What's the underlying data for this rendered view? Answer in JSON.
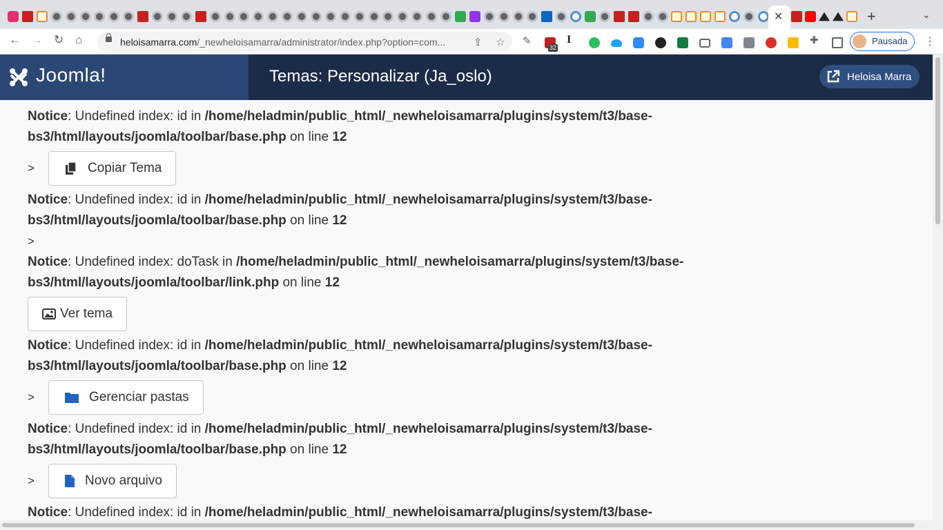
{
  "browser": {
    "tab_close": "✕",
    "new_tab": "+",
    "url_host": "heloisamarra.com",
    "url_path": "/_newheloisamarra/administrator/index.php?option=com...",
    "ext_badge": "32",
    "profile_label": "Pausada",
    "nav_icons": [
      "back-icon",
      "forward-icon",
      "reload-icon",
      "home-icon"
    ]
  },
  "header": {
    "logo_text": "Joomla!",
    "title": "Temas: Personalizar (Ja_oslo)",
    "user_name": "Heloisa Marra"
  },
  "notices": [
    {
      "label": "Notice",
      "msg": ": Undefined index: id in ",
      "path": "/home/heladmin/public_html/_newheloisamarra/plugins/system/t3/base-bs3/html/layouts/joomla/toolbar/base.php",
      "online": " on line ",
      "line": "12"
    },
    {
      "label": "Notice",
      "msg": ": Undefined index: id in ",
      "path": "/home/heladmin/public_html/_newheloisamarra/plugins/system/t3/base-bs3/html/layouts/joomla/toolbar/base.php",
      "online": " on line ",
      "line": "12"
    },
    {
      "label": "Notice",
      "msg": ": Undefined index: doTask in ",
      "path": "/home/heladmin/public_html/_newheloisamarra/plugins/system/t3/base-bs3/html/layouts/joomla/toolbar/link.php",
      "online": " on line ",
      "line": "12"
    },
    {
      "label": "Notice",
      "msg": ": Undefined index: id in ",
      "path": "/home/heladmin/public_html/_newheloisamarra/plugins/system/t3/base-bs3/html/layouts/joomla/toolbar/base.php",
      "online": " on line ",
      "line": "12"
    },
    {
      "label": "Notice",
      "msg": ": Undefined index: id in ",
      "path": "/home/heladmin/public_html/_newheloisamarra/plugins/system/t3/base-bs3/html/layouts/joomla/toolbar/base.php",
      "online": " on line ",
      "line": "12"
    },
    {
      "label": "Notice",
      "msg": ": Undefined index: id in ",
      "path": "/home/heladmin/public_html/_newheloisamarra/plugins/system/t3/base-",
      "online": "",
      "line": ""
    }
  ],
  "gt": ">",
  "buttons": {
    "copy": "Copiar Tema",
    "view": "Ver tema",
    "folders": "Gerenciar pastas",
    "newfile": "Novo arquivo"
  },
  "colors": {
    "header_bg": "#1c2b48",
    "logo_bg": "#2a4775",
    "icon_blue": "#1f63c4"
  }
}
